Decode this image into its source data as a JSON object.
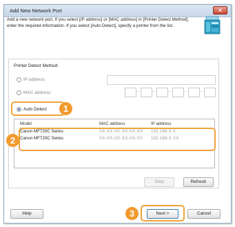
{
  "dialog": {
    "title": "Add New Network Port",
    "close_glyph": "✕",
    "description": "Add a new network port. If you select [IP address] or [MAC address] in [Printer Detect Method], enter the required information. If you select [Auto Detect], specify a printer from the list."
  },
  "detect": {
    "label": "Printer Detect Method:",
    "options": [
      {
        "label": "IP address",
        "selected": false
      },
      {
        "label": "MAC address",
        "selected": false
      },
      {
        "label": "Auto Detect",
        "selected": true
      }
    ],
    "ip_separator": ".",
    "mac_separator": "-"
  },
  "printer_list": {
    "columns": [
      "Model",
      "MAC address",
      "IP address"
    ],
    "rows": [
      {
        "model": "Canon MF720C Series",
        "mac": "XX-XX-XX-XX-XX-XX",
        "ip": "192.168.X.X"
      },
      {
        "model": "Canon MF720C Series",
        "mac": "XX-XX-XX-XX-XX-XX",
        "ip": "192.168.X.XX"
      }
    ]
  },
  "buttons": {
    "stop": "Stop",
    "refresh": "Refresh",
    "help": "Help",
    "next": "Next >",
    "cancel": "Cancel"
  },
  "callouts": [
    "1",
    "2",
    "3"
  ],
  "colors": {
    "callout": "#f29a2e",
    "titlebar": "#c7d7ea",
    "close_button": "#c9452e"
  },
  "icons": {
    "printer": "printer-icon",
    "close": "close-icon"
  }
}
